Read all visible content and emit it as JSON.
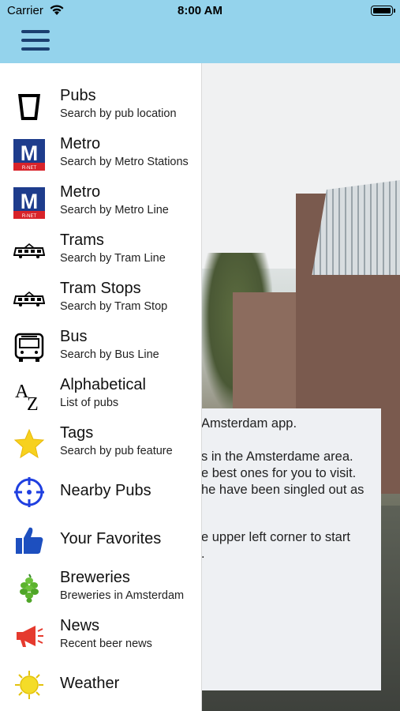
{
  "status_bar": {
    "carrier": "Carrier",
    "time": "8:00 AM"
  },
  "nav": {
    "menu_icon": "hamburger-icon"
  },
  "background_text": [
    "Amsterdam app.",
    "s in the Amsterdame area.",
    "e best ones for you to visit.",
    "he have been singled out as",
    "e upper left corner to start",
    "."
  ],
  "menu": [
    {
      "title": "Pubs",
      "subtitle": "Search by pub location",
      "icon": "beer-glass-icon"
    },
    {
      "title": "Metro",
      "subtitle": "Search by Metro Stations",
      "icon": "metro-icon"
    },
    {
      "title": "Metro",
      "subtitle": "Search by Metro Line",
      "icon": "metro-icon"
    },
    {
      "title": "Trams",
      "subtitle": "Search by Tram Line",
      "icon": "tram-icon"
    },
    {
      "title": "Tram Stops",
      "subtitle": "Search by Tram Stop",
      "icon": "tram-icon"
    },
    {
      "title": "Bus",
      "subtitle": "Search by Bus Line",
      "icon": "bus-icon"
    },
    {
      "title": "Alphabetical",
      "subtitle": "List of pubs",
      "icon": "az-icon"
    },
    {
      "title": "Tags",
      "subtitle": "Search by pub feature",
      "icon": "star-icon"
    },
    {
      "title": "Nearby Pubs",
      "subtitle": "",
      "icon": "crosshair-icon"
    },
    {
      "title": "Your Favorites",
      "subtitle": "",
      "icon": "thumbs-up-icon"
    },
    {
      "title": "Breweries",
      "subtitle": "Breweries in Amsterdam",
      "icon": "hops-icon"
    },
    {
      "title": "News",
      "subtitle": "Recent beer news",
      "icon": "megaphone-icon"
    },
    {
      "title": "Weather",
      "subtitle": "",
      "icon": "sun-icon"
    }
  ],
  "metro_badge": "R-NET",
  "colors": {
    "nav_bar": "#94d3ec",
    "menu_icon": "#1b3f70",
    "metro_blue": "#1e3c8c",
    "metro_red": "#d8232a"
  }
}
